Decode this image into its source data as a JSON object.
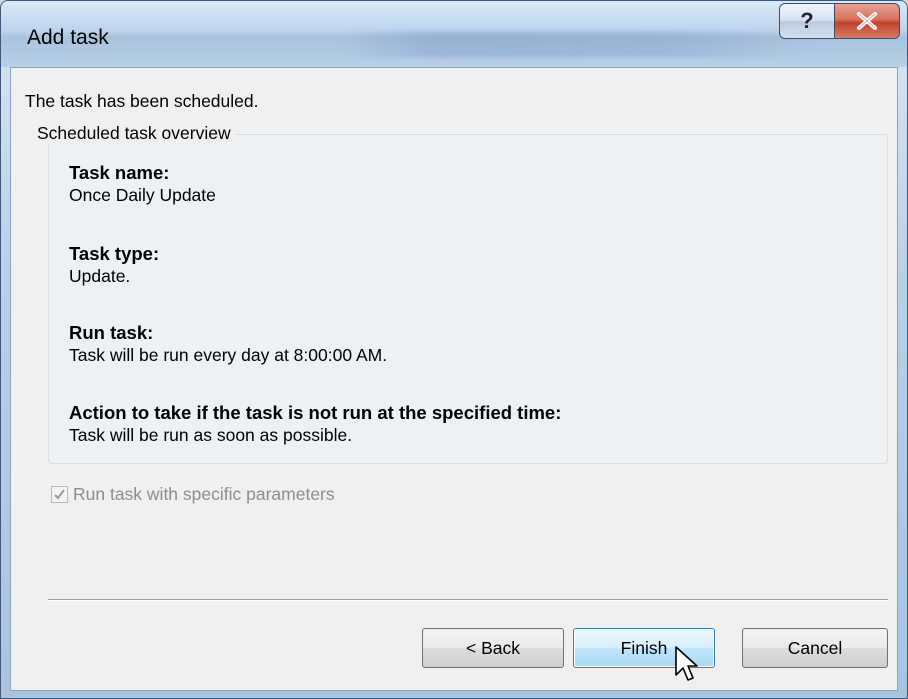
{
  "window": {
    "title": "Add task",
    "help_label": "?",
    "close_label": "close"
  },
  "main": {
    "status_text": "The task has been scheduled.",
    "group_title": "Scheduled task overview",
    "sections": [
      {
        "heading": "Task name:",
        "value": "Once Daily Update"
      },
      {
        "heading": "Task type:",
        "value": "Update."
      },
      {
        "heading": "Run task:",
        "value": "Task will be run every day at 8:00:00 AM."
      },
      {
        "heading": "Action to take if the task is not run at the specified time:",
        "value": "Task will be run as soon as possible."
      }
    ],
    "checkbox": {
      "label": "Run task with specific parameters",
      "checked": true,
      "enabled": false
    }
  },
  "buttons": {
    "back": "< Back",
    "finish": "Finish",
    "cancel": "Cancel"
  },
  "colors": {
    "accent": "#3c7fb1",
    "close": "#c0432a"
  },
  "icons": [
    "help-icon",
    "close-icon",
    "checkmark-icon",
    "mouse-pointer-icon"
  ]
}
